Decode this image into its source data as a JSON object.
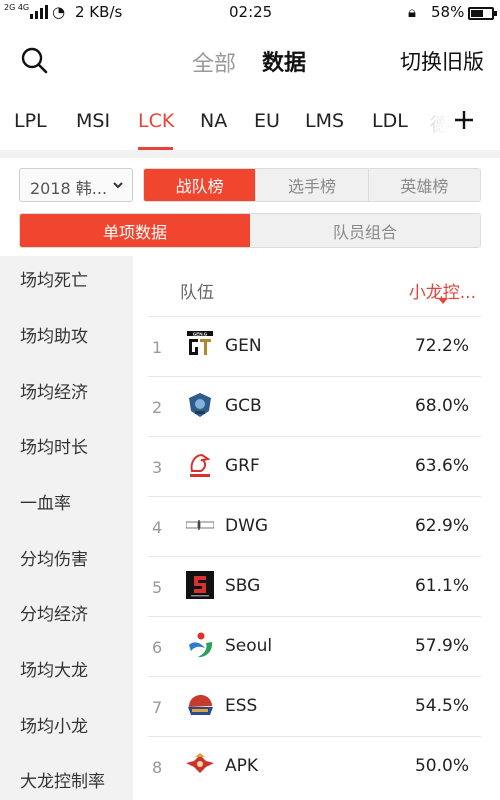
{
  "status_bar": {
    "network": "2G 4G",
    "speed": "2 KB/s",
    "time": "02:25",
    "battery": "58%",
    "battery_level": 0.58
  },
  "header": {
    "tab_all": "全部",
    "tab_data": "数据",
    "switch_label": "切换旧版",
    "search_icon": "search-icon"
  },
  "leagues": {
    "items": [
      "LPL",
      "MSI",
      "LCK",
      "NA",
      "EU",
      "LMS",
      "LDL",
      "德"
    ],
    "active": "LCK",
    "add_icon": "plus-icon"
  },
  "filters": {
    "season": "2018 韩...",
    "rank_tabs": [
      "战队榜",
      "选手榜",
      "英雄榜"
    ],
    "rank_active": "战队榜",
    "mode_tabs": [
      "单项数据",
      "队员组合"
    ],
    "mode_active": "单项数据"
  },
  "sidebar": {
    "items": [
      "场均死亡",
      "场均助攻",
      "场均经济",
      "场均时长",
      "一血率",
      "分均伤害",
      "分均经济",
      "场均大龙",
      "场均小龙",
      "大龙控制率"
    ]
  },
  "table": {
    "col_team": "队伍",
    "col_metric": "小龙控...",
    "rows": [
      {
        "rank": "1",
        "team": "GEN",
        "value": "72.2%",
        "logo_icon": "gen-g-logo-icon"
      },
      {
        "rank": "2",
        "team": "GCB",
        "value": "68.0%",
        "logo_icon": "gcb-logo-icon"
      },
      {
        "rank": "3",
        "team": "GRF",
        "value": "63.6%",
        "logo_icon": "griffin-logo-icon"
      },
      {
        "rank": "4",
        "team": "DWG",
        "value": "62.9%",
        "logo_icon": "damwon-logo-icon"
      },
      {
        "rank": "5",
        "team": "SBG",
        "value": "61.1%",
        "logo_icon": "sandbox-logo-icon"
      },
      {
        "rank": "6",
        "team": "Seoul",
        "value": "57.9%",
        "logo_icon": "seoul-logo-icon"
      },
      {
        "rank": "7",
        "team": "ESS",
        "value": "54.5%",
        "logo_icon": "ess-logo-icon"
      },
      {
        "rank": "8",
        "team": "APK",
        "value": "50.0%",
        "logo_icon": "apk-logo-icon"
      }
    ]
  },
  "colors": {
    "accent": "#e8433a",
    "segment_active": "#f0462f",
    "sidebar_bg": "#f2f2f2"
  }
}
